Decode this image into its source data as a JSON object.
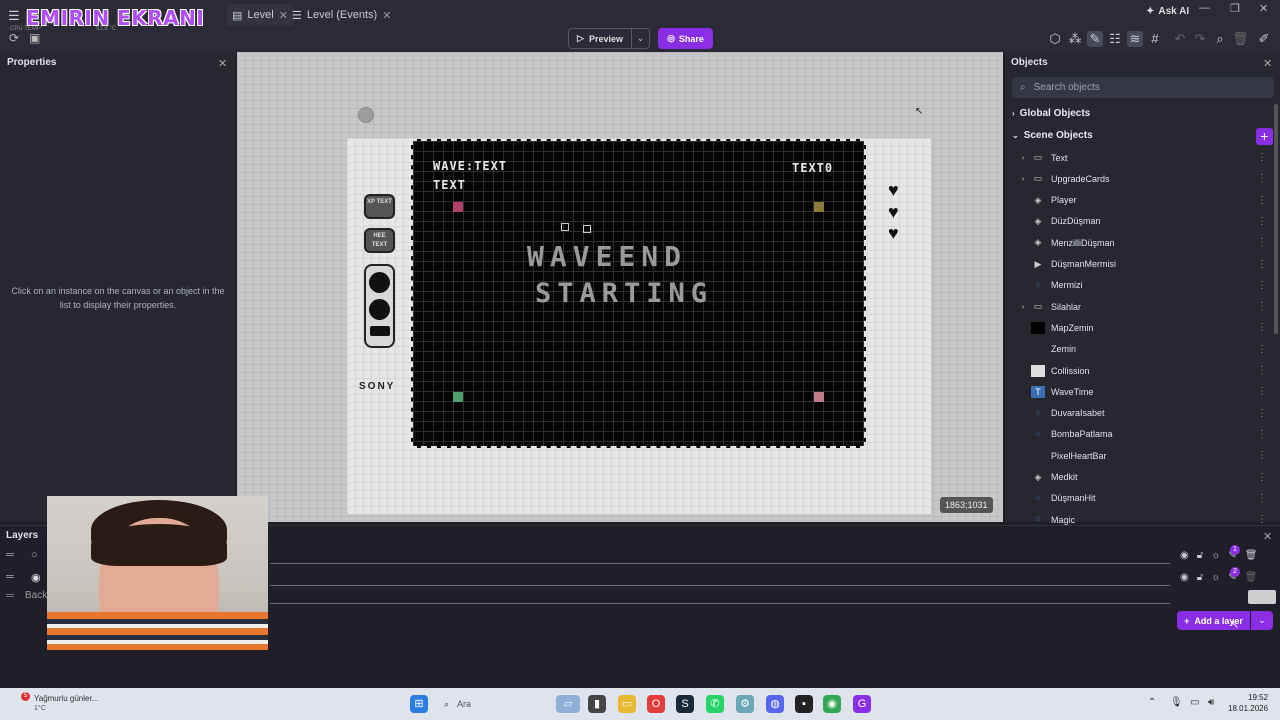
{
  "title_bar": {
    "overlay_title": "EMIRIN EKRANI",
    "tabs": [
      {
        "label": "Level",
        "active": true
      },
      {
        "label": "Level (Events)",
        "active": false
      }
    ],
    "ask_ai": "Ask AI",
    "cpu_label": "CPU TEMP",
    "cpu_value": "53.8 °C"
  },
  "toolbar": {
    "preview_label": "Preview",
    "share_label": "Share"
  },
  "properties": {
    "title": "Properties",
    "hint": "Click on an instance on the canvas or an object in the list to display their properties."
  },
  "canvas": {
    "wave_label": "WAVE:TEXT",
    "text_label": "TEXT",
    "right_label": "TEXT0",
    "center_line1": "WAVEEND",
    "center_line2": "STARTING",
    "badge1": "XP TEXT",
    "badge2": "HEE TEXT",
    "brand": "SONY",
    "coords": "1863;1031",
    "colors": {
      "pink": "#b0406a",
      "gold": "#8c7a3a",
      "green": "#4fa06e",
      "rose": "#c07a8a"
    }
  },
  "objects": {
    "title": "Objects",
    "search_placeholder": "Search objects",
    "global_label": "Global Objects",
    "scene_label": "Scene Objects",
    "items": [
      {
        "name": "Text",
        "icon": "folder-icon",
        "expandable": true
      },
      {
        "name": "UpgradeCards",
        "icon": "folder-icon",
        "expandable": true
      },
      {
        "name": "Player",
        "icon": "sprite-icon",
        "expandable": false
      },
      {
        "name": "DüzDüşman",
        "icon": "sprite-icon",
        "expandable": false
      },
      {
        "name": "MenzilliDüşman",
        "icon": "sprite-icon",
        "expandable": false
      },
      {
        "name": "DüşmanMermisi",
        "icon": "play-icon",
        "expandable": false
      },
      {
        "name": "Mermizi",
        "icon": "particle-icon",
        "expandable": false
      },
      {
        "name": "Silahlar",
        "icon": "folder-icon",
        "expandable": true
      },
      {
        "name": "MapZemin",
        "icon": "black-square-icon",
        "expandable": false
      },
      {
        "name": "Zemin",
        "icon": "none",
        "expandable": false
      },
      {
        "name": "Collission",
        "icon": "white-square-icon",
        "expandable": false
      },
      {
        "name": "WaveTime",
        "icon": "text-icon",
        "expandable": false
      },
      {
        "name": "DuvaraIsabet",
        "icon": "particle-icon",
        "expandable": false
      },
      {
        "name": "BombaPatlama",
        "icon": "particle-icon",
        "expandable": false
      },
      {
        "name": "PixelHeartBar",
        "icon": "none",
        "expandable": false
      },
      {
        "name": "Medkit",
        "icon": "sprite-icon",
        "expandable": false
      },
      {
        "name": "DüşmanHit",
        "icon": "particle-icon",
        "expandable": false
      },
      {
        "name": "Magic",
        "icon": "particle-icon",
        "expandable": false
      }
    ]
  },
  "layers": {
    "title": "Layers",
    "background_label": "Back",
    "add_label": "Add a layer",
    "badges": [
      "1",
      "2"
    ]
  },
  "taskbar": {
    "weather": "Yağmurlu günler...",
    "weather_temp": "1°C",
    "weather_badge": "5",
    "search_label": "Ara",
    "time": "19:52",
    "date": "18.01.2026"
  }
}
